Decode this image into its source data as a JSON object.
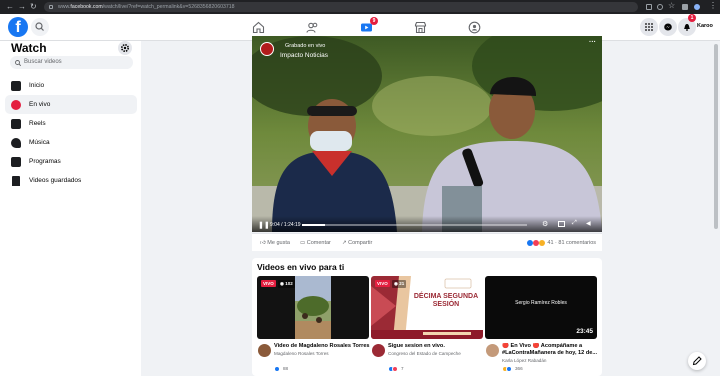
{
  "browser": {
    "url_host": "facebook.com",
    "url_path": "/watch/live/?ref=watch_permalink&v=5268356820603718",
    "url_prefix": "www."
  },
  "header": {
    "logo": "f",
    "notification_count": "1",
    "watch_badge": "9",
    "profile_label": "Karoo"
  },
  "sidebar": {
    "title": "Watch",
    "search_placeholder": "Buscar videos",
    "items": [
      {
        "label": "Inicio",
        "icon": "home-play-icon"
      },
      {
        "label": "En vivo",
        "icon": "live-icon"
      },
      {
        "label": "Reels",
        "icon": "reels-icon"
      },
      {
        "label": "Música",
        "icon": "music-icon"
      },
      {
        "label": "Programas",
        "icon": "shows-icon"
      },
      {
        "label": "Videos guardados",
        "icon": "bookmark-icon"
      }
    ]
  },
  "video": {
    "status": "Grabado en vivo",
    "channel": "Impacto Noticias",
    "time": "9:04 / 1:24:19",
    "progress": 0.1
  },
  "actions": {
    "like": "Me gusta",
    "comment": "Comentar",
    "share": "Compartir",
    "stats": "41 · 81 comentarios"
  },
  "live_section": {
    "title": "Videos en vivo para ti",
    "videos": [
      {
        "badge": "VIVO",
        "viewers": "102",
        "title": "Video de Magdaleno Rosales Torres",
        "author": "Magdaleno Rosales Torres",
        "reactions": "88"
      },
      {
        "badge": "VIVO",
        "viewers": "21",
        "title": "Sigue sesion en vivo.",
        "author": "Congreso del Estado de Campeche",
        "reactions": "7",
        "thumb_heading_1": "DÉCIMA SEGUNDA",
        "thumb_heading_2": "SESIÓN"
      },
      {
        "duration": "23:45",
        "thumb_name": "Sergio Ramírez Robles",
        "title": "🔴 En Vivo 🔴 Acompáñame a #LaContraMañanera de hoy, 12 de...",
        "author": "Karla López Rabadán",
        "reactions": "366"
      }
    ]
  },
  "colors": {
    "brand": "#1877f2",
    "live_red": "#e41e3f",
    "background": "#f0f2f5"
  }
}
